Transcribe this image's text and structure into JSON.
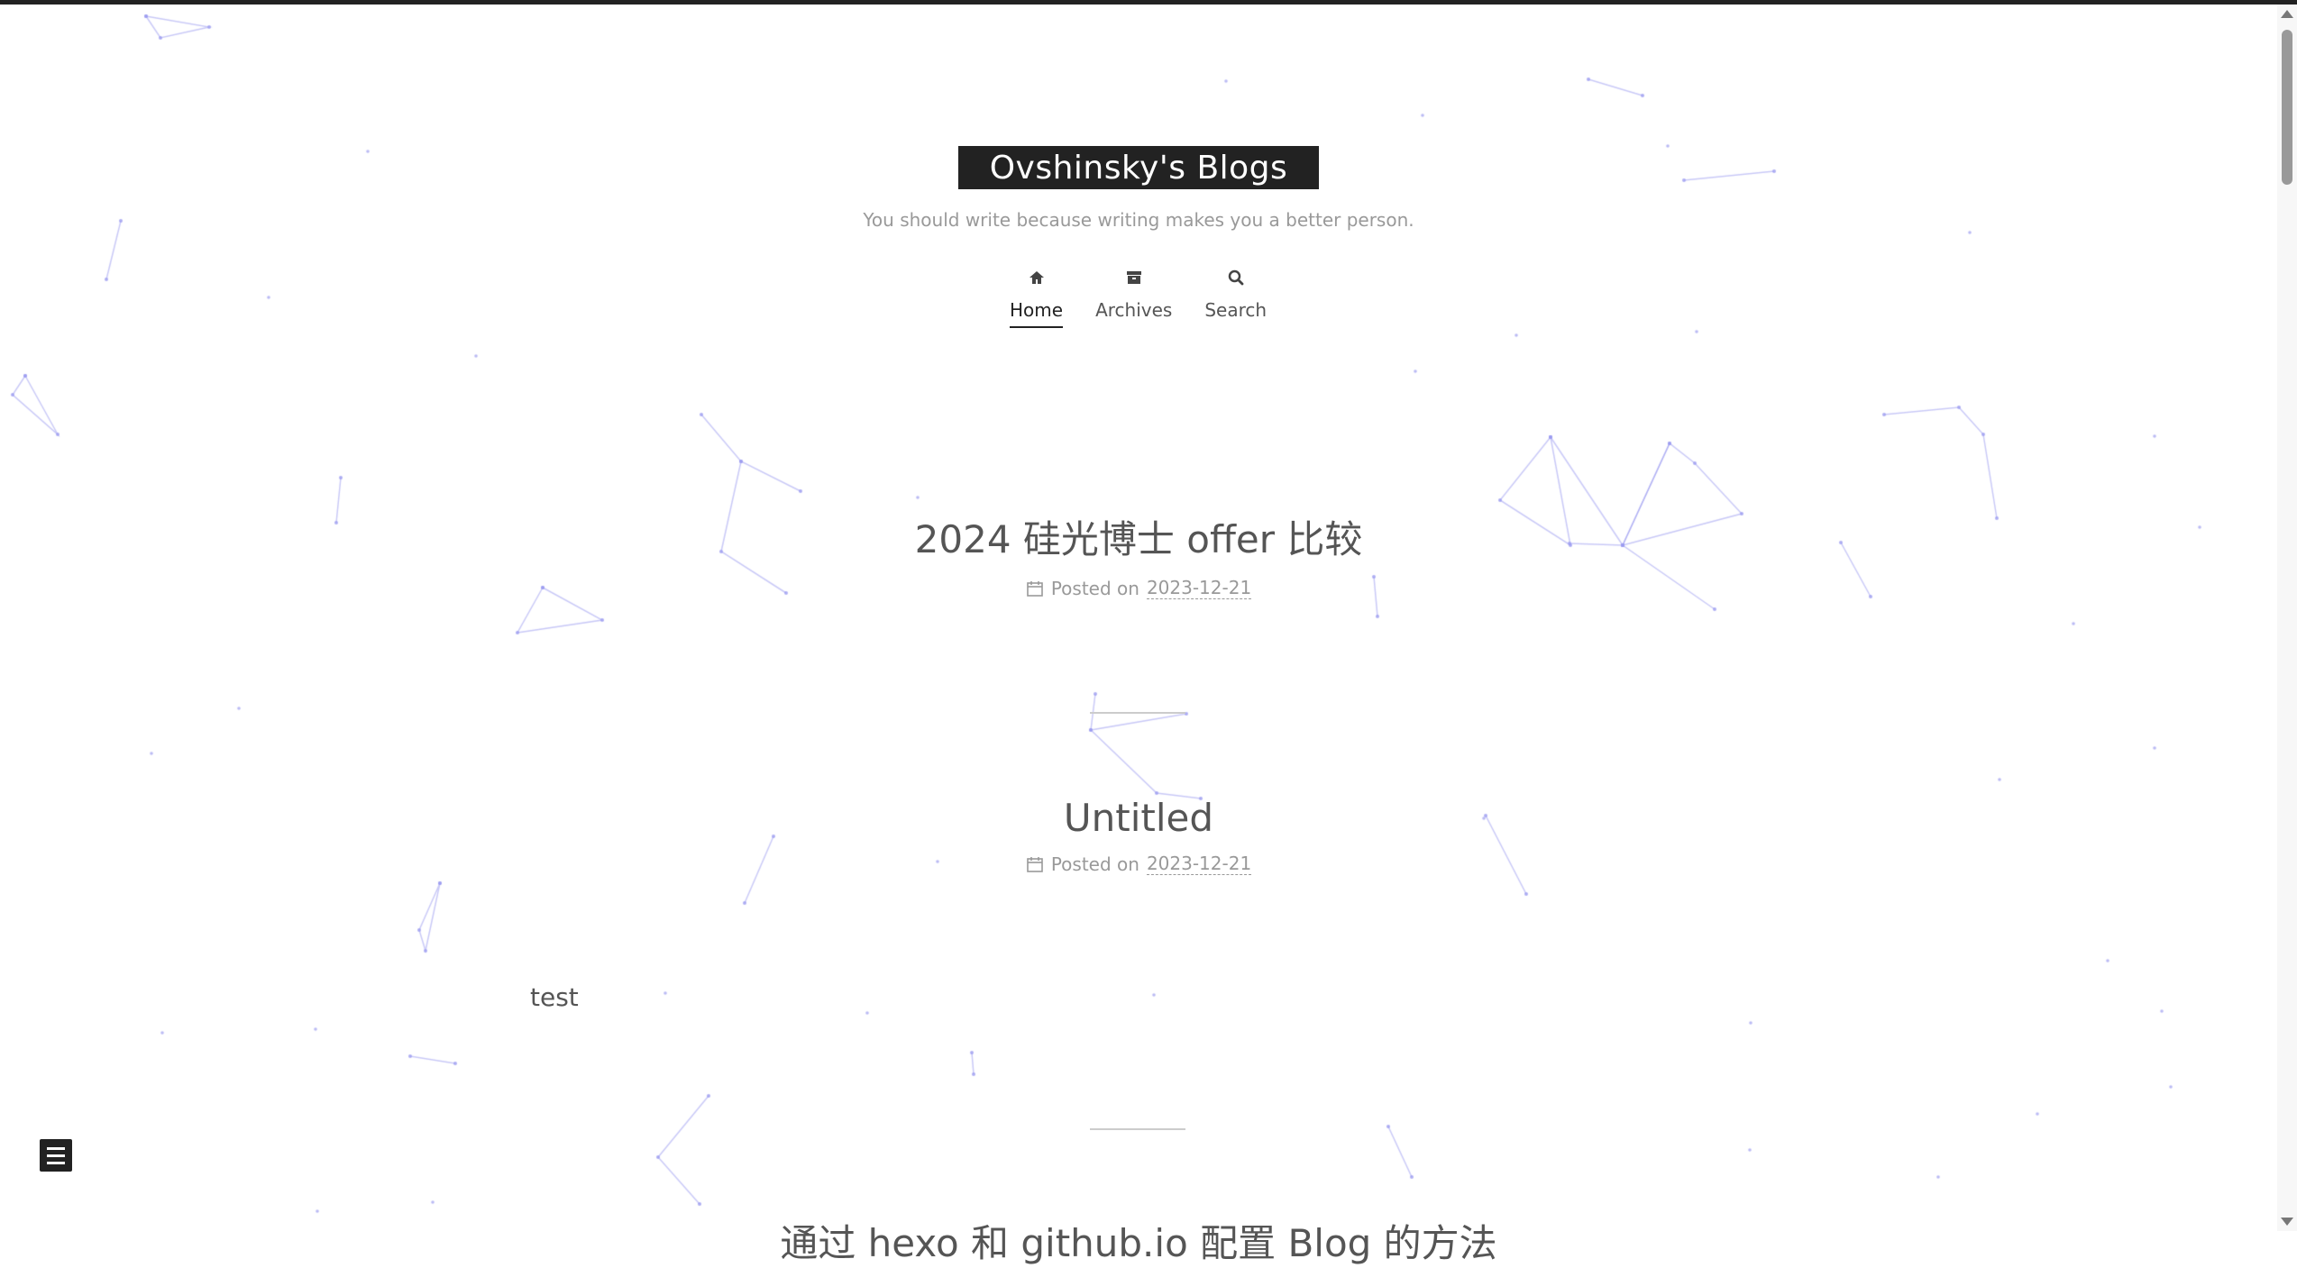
{
  "site": {
    "title": "Ovshinsky's Blogs",
    "subtitle": "You should write because writing makes you a better person."
  },
  "nav": [
    {
      "label": "Home",
      "icon": "home-icon",
      "active": true
    },
    {
      "label": "Archives",
      "icon": "archive-icon",
      "active": false
    },
    {
      "label": "Search",
      "icon": "search-icon",
      "active": false
    }
  ],
  "posts": [
    {
      "title": "2024 硅光博士 offer 比较",
      "meta_label": "Posted on",
      "date": "2023-12-21",
      "body": ""
    },
    {
      "title": "Untitled",
      "meta_label": "Posted on",
      "date": "2023-12-21",
      "body": "test"
    },
    {
      "title": "通过 hexo 和 github.io 配置 Blog 的方法",
      "meta_label": "",
      "date": "",
      "body": ""
    }
  ],
  "colors": {
    "accent": "#222222",
    "meta": "#999999",
    "particles": "#9c9cf0"
  }
}
